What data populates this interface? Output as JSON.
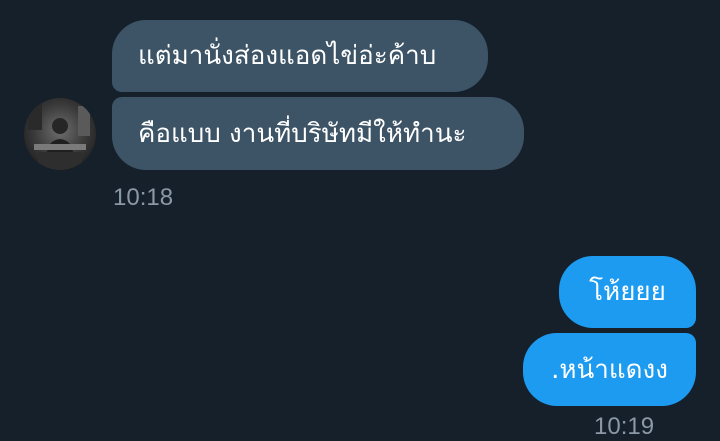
{
  "conversation": {
    "incoming": [
      {
        "text": "แต่มานั่งส่องแอดไข่อ่ะค้าบ"
      },
      {
        "text": "คือแบบ งานที่บริษัทมีให้ทำนะ"
      }
    ],
    "incoming_time": "10:18",
    "outgoing": [
      {
        "text": "โห้ยยย"
      },
      {
        "text": ".หน้าแดงง"
      }
    ],
    "outgoing_time": "10:19"
  },
  "colors": {
    "background": "#15202b",
    "incoming_bubble": "#3d5466",
    "outgoing_bubble": "#1d9bf0",
    "timestamp": "#8b98a5"
  }
}
